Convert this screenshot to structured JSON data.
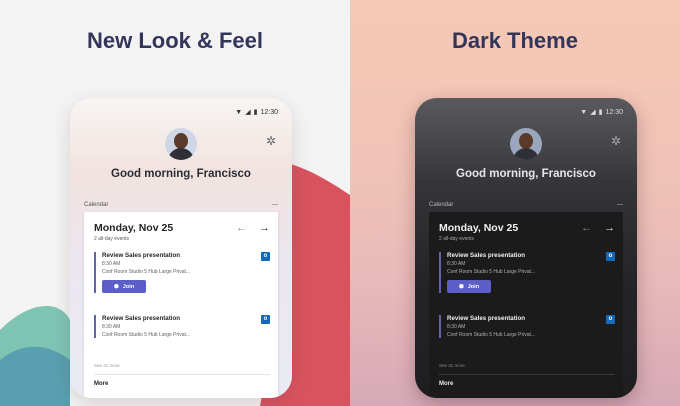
{
  "left": {
    "headline": "New Look & Feel",
    "phone": {
      "status_time": "12:30",
      "greeting": "Good morning, Francisco",
      "calendar_label": "Calendar",
      "menu_glyph": "—",
      "date": "Monday, Nov 25",
      "all_day": "2 all-day events",
      "events": [
        {
          "title": "Review Sales presentation",
          "time": "8:30 AM",
          "location": "Conf Room Studio 5 Hub Large Privat...",
          "join_label": "Join"
        },
        {
          "title": "Review Sales presentation",
          "time": "8:30 AM",
          "location": "Conf Room Studio 5 Hub Large Privat..."
        }
      ],
      "see_all": "See 31 more",
      "more_label": "More"
    }
  },
  "right": {
    "headline": "Dark Theme",
    "phone": {
      "status_time": "12:30",
      "greeting": "Good morning, Francisco",
      "calendar_label": "Calendar",
      "menu_glyph": "—",
      "date": "Monday, Nov 25",
      "all_day": "2 all-day events",
      "events": [
        {
          "title": "Review Sales presentation",
          "time": "8:30 AM",
          "location": "Conf Room Studio 5 Hub Large Privat...",
          "join_label": "Join"
        },
        {
          "title": "Review Sales presentation",
          "time": "8:30 AM",
          "location": "Conf Room Studio 5 Hub Large Privat..."
        }
      ],
      "see_all": "See 31 more",
      "more_label": "More"
    }
  },
  "icons": {
    "wifi": "wifi-icon",
    "signal": "signal-icon",
    "battery": "battery-icon",
    "settings": "gear-icon",
    "prev": "arrow-left-icon",
    "next": "arrow-right-icon",
    "outlook": "outlook-icon",
    "teams": "teams-icon"
  },
  "colors": {
    "headline": "#34355a",
    "teams_purple": "#5b5fc7",
    "outlook_blue": "#0f6cbd",
    "accent_red": "#d9535f"
  }
}
